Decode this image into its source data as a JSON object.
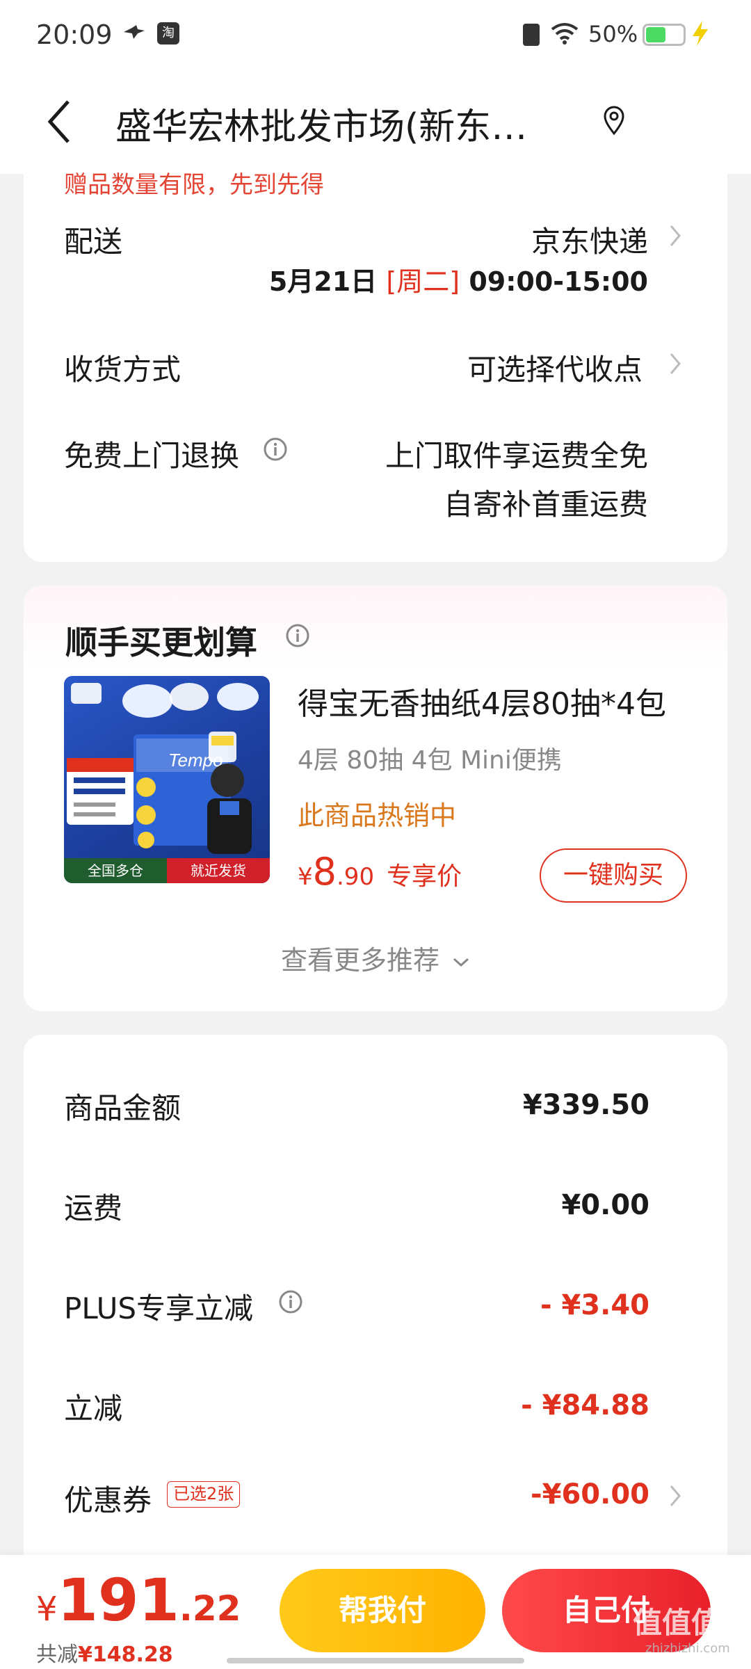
{
  "status_bar": {
    "time": "20:09",
    "app_icon_1": "swallow-icon",
    "app_icon_2_label": "淘",
    "battery_percent": "50%",
    "battery_level": 0.5
  },
  "header": {
    "title": "盛华宏林批发市场(新东…"
  },
  "delivery": {
    "peek_text": "赠品数量有限，先到先得",
    "shipping_label": "配送",
    "shipping_carrier": "京东快递",
    "shipping_date": "5月21日",
    "shipping_weekday": "[周二]",
    "shipping_time": "09:00-15:00",
    "receive_label": "收货方式",
    "receive_value": "可选择代收点",
    "return_label": "免费上门退换",
    "return_value_1": "上门取件享运费全免",
    "return_value_2": "自寄补首重运费"
  },
  "upsell": {
    "title": "顺手买更划算",
    "product": {
      "image_badge_left": "全国多仓",
      "image_badge_right": "就近发货",
      "name": "得宝无香抽纸4层80抽*4包",
      "spec": "4层 80抽 4包 Mini便携",
      "hot": "此商品热销中",
      "price_symbol": "¥",
      "price_int": "8",
      "price_dec": ".90",
      "price_tag": "专享价",
      "buy_button": "一键购买"
    },
    "more": "查看更多推荐"
  },
  "summary": {
    "goods_label": "商品金额",
    "goods_value": "¥339.50",
    "freight_label": "运费",
    "freight_value": "¥0.00",
    "plus_label": "PLUS专享立减",
    "plus_value": "- ¥3.40",
    "discount_label": "立减",
    "discount_value": "- ¥84.88",
    "coupon_label": "优惠券",
    "coupon_tag": "已选2张",
    "coupon_value": "-¥60.00"
  },
  "bottom_bar": {
    "total_symbol": "¥",
    "total_int": "191",
    "total_dec": ".22",
    "saved_label": "共减",
    "saved_value": "¥148.28",
    "help_pay": "帮我付",
    "self_pay": "自己付",
    "watermark": "值值值",
    "watermark_sub": "zhizhizhi.com"
  },
  "colors": {
    "accent_red": "#e0301e",
    "hot_orange": "#d9781c",
    "help_yellow": "#ffc91a",
    "self_red": "#e8202a"
  }
}
